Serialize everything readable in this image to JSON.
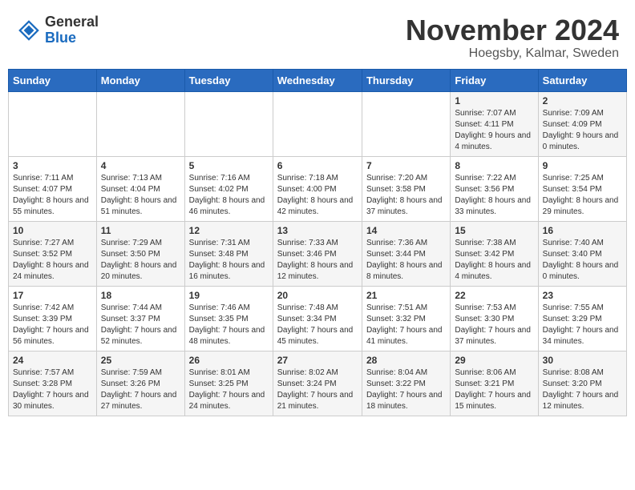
{
  "logo": {
    "general": "General",
    "blue": "Blue"
  },
  "title": "November 2024",
  "location": "Hoegsby, Kalmar, Sweden",
  "days_header": [
    "Sunday",
    "Monday",
    "Tuesday",
    "Wednesday",
    "Thursday",
    "Friday",
    "Saturday"
  ],
  "weeks": [
    [
      {
        "num": "",
        "info": ""
      },
      {
        "num": "",
        "info": ""
      },
      {
        "num": "",
        "info": ""
      },
      {
        "num": "",
        "info": ""
      },
      {
        "num": "",
        "info": ""
      },
      {
        "num": "1",
        "info": "Sunrise: 7:07 AM\nSunset: 4:11 PM\nDaylight: 9 hours and 4 minutes."
      },
      {
        "num": "2",
        "info": "Sunrise: 7:09 AM\nSunset: 4:09 PM\nDaylight: 9 hours and 0 minutes."
      }
    ],
    [
      {
        "num": "3",
        "info": "Sunrise: 7:11 AM\nSunset: 4:07 PM\nDaylight: 8 hours and 55 minutes."
      },
      {
        "num": "4",
        "info": "Sunrise: 7:13 AM\nSunset: 4:04 PM\nDaylight: 8 hours and 51 minutes."
      },
      {
        "num": "5",
        "info": "Sunrise: 7:16 AM\nSunset: 4:02 PM\nDaylight: 8 hours and 46 minutes."
      },
      {
        "num": "6",
        "info": "Sunrise: 7:18 AM\nSunset: 4:00 PM\nDaylight: 8 hours and 42 minutes."
      },
      {
        "num": "7",
        "info": "Sunrise: 7:20 AM\nSunset: 3:58 PM\nDaylight: 8 hours and 37 minutes."
      },
      {
        "num": "8",
        "info": "Sunrise: 7:22 AM\nSunset: 3:56 PM\nDaylight: 8 hours and 33 minutes."
      },
      {
        "num": "9",
        "info": "Sunrise: 7:25 AM\nSunset: 3:54 PM\nDaylight: 8 hours and 29 minutes."
      }
    ],
    [
      {
        "num": "10",
        "info": "Sunrise: 7:27 AM\nSunset: 3:52 PM\nDaylight: 8 hours and 24 minutes."
      },
      {
        "num": "11",
        "info": "Sunrise: 7:29 AM\nSunset: 3:50 PM\nDaylight: 8 hours and 20 minutes."
      },
      {
        "num": "12",
        "info": "Sunrise: 7:31 AM\nSunset: 3:48 PM\nDaylight: 8 hours and 16 minutes."
      },
      {
        "num": "13",
        "info": "Sunrise: 7:33 AM\nSunset: 3:46 PM\nDaylight: 8 hours and 12 minutes."
      },
      {
        "num": "14",
        "info": "Sunrise: 7:36 AM\nSunset: 3:44 PM\nDaylight: 8 hours and 8 minutes."
      },
      {
        "num": "15",
        "info": "Sunrise: 7:38 AM\nSunset: 3:42 PM\nDaylight: 8 hours and 4 minutes."
      },
      {
        "num": "16",
        "info": "Sunrise: 7:40 AM\nSunset: 3:40 PM\nDaylight: 8 hours and 0 minutes."
      }
    ],
    [
      {
        "num": "17",
        "info": "Sunrise: 7:42 AM\nSunset: 3:39 PM\nDaylight: 7 hours and 56 minutes."
      },
      {
        "num": "18",
        "info": "Sunrise: 7:44 AM\nSunset: 3:37 PM\nDaylight: 7 hours and 52 minutes."
      },
      {
        "num": "19",
        "info": "Sunrise: 7:46 AM\nSunset: 3:35 PM\nDaylight: 7 hours and 48 minutes."
      },
      {
        "num": "20",
        "info": "Sunrise: 7:48 AM\nSunset: 3:34 PM\nDaylight: 7 hours and 45 minutes."
      },
      {
        "num": "21",
        "info": "Sunrise: 7:51 AM\nSunset: 3:32 PM\nDaylight: 7 hours and 41 minutes."
      },
      {
        "num": "22",
        "info": "Sunrise: 7:53 AM\nSunset: 3:30 PM\nDaylight: 7 hours and 37 minutes."
      },
      {
        "num": "23",
        "info": "Sunrise: 7:55 AM\nSunset: 3:29 PM\nDaylight: 7 hours and 34 minutes."
      }
    ],
    [
      {
        "num": "24",
        "info": "Sunrise: 7:57 AM\nSunset: 3:28 PM\nDaylight: 7 hours and 30 minutes."
      },
      {
        "num": "25",
        "info": "Sunrise: 7:59 AM\nSunset: 3:26 PM\nDaylight: 7 hours and 27 minutes."
      },
      {
        "num": "26",
        "info": "Sunrise: 8:01 AM\nSunset: 3:25 PM\nDaylight: 7 hours and 24 minutes."
      },
      {
        "num": "27",
        "info": "Sunrise: 8:02 AM\nSunset: 3:24 PM\nDaylight: 7 hours and 21 minutes."
      },
      {
        "num": "28",
        "info": "Sunrise: 8:04 AM\nSunset: 3:22 PM\nDaylight: 7 hours and 18 minutes."
      },
      {
        "num": "29",
        "info": "Sunrise: 8:06 AM\nSunset: 3:21 PM\nDaylight: 7 hours and 15 minutes."
      },
      {
        "num": "30",
        "info": "Sunrise: 8:08 AM\nSunset: 3:20 PM\nDaylight: 7 hours and 12 minutes."
      }
    ]
  ]
}
